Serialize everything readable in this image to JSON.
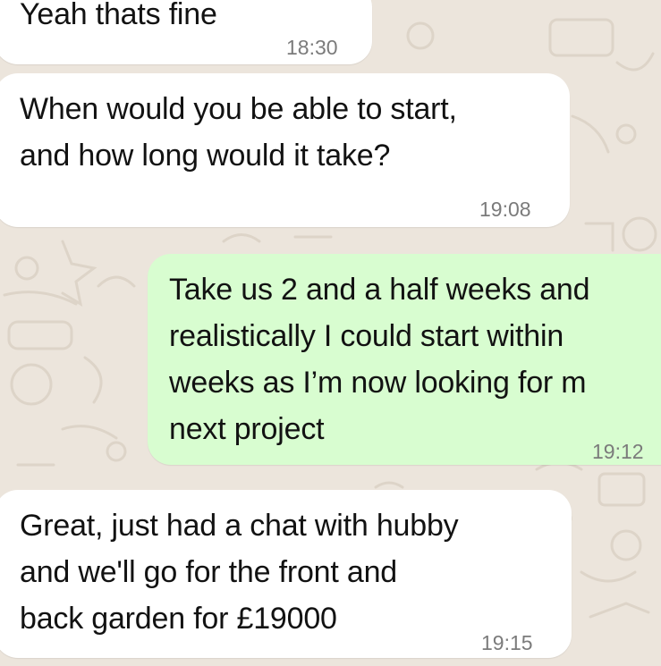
{
  "chat": {
    "messages": [
      {
        "direction": "incoming",
        "text": "Yeah thats fine",
        "time": "18:30"
      },
      {
        "direction": "incoming",
        "text": "When would you be able to start,\nand how long would it take?",
        "time": "19:08"
      },
      {
        "direction": "outgoing",
        "text": "Take us 2 and a half weeks and\nrealistically I could start within\nweeks as I’m now looking for m\nnext project",
        "time": "19:12"
      },
      {
        "direction": "incoming",
        "text": "Great, just had a chat with hubby\nand we'll go for the front and\nback garden for £19000",
        "time": "19:15"
      }
    ]
  },
  "colors": {
    "wallpaper": "#ece5dc",
    "incoming_bubble": "#ffffff",
    "outgoing_bubble": "#d8fdd0",
    "text": "#121212",
    "timestamp": "#7b7b7b"
  }
}
